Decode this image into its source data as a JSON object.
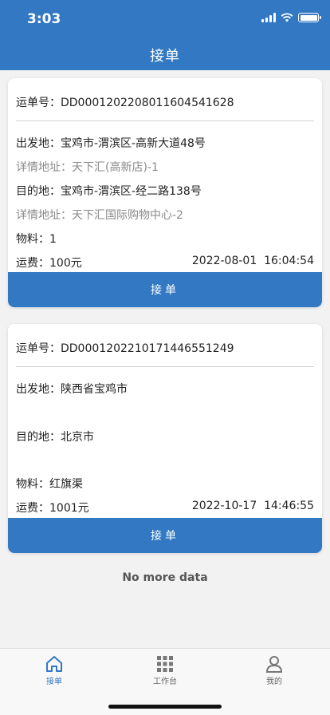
{
  "status_bar": {
    "time": "3:03"
  },
  "header": {
    "title": "接单"
  },
  "orders": [
    {
      "waybill_label": "运单号：",
      "waybill_no": "DD0001202208011604541628",
      "origin_label": "出发地：",
      "origin": "宝鸡市-渭滨区-高新大道48号",
      "origin_detail_label": "详情地址：",
      "origin_detail": "天下汇(高新店)-1",
      "dest_label": "目的地：",
      "dest": "宝鸡市-渭滨区-经二路138号",
      "dest_detail_label": "详情地址：",
      "dest_detail": "天下汇国际购物中心-2",
      "material_label": "物料：",
      "material": "1",
      "fee_label": "运费：",
      "fee": "100元",
      "datetime": "2022-08-01  16:04:54",
      "accept_label": "接单"
    },
    {
      "waybill_label": "运单号：",
      "waybill_no": "DD0001202210171446551249",
      "origin_label": "出发地：",
      "origin": "陕西省宝鸡市",
      "dest_label": "目的地：",
      "dest": "北京市",
      "material_label": "物料：",
      "material": "红旗渠",
      "fee_label": "运费：",
      "fee": "1001元",
      "datetime": "2022-10-17  14:46:55",
      "accept_label": "接单"
    }
  ],
  "list_footer": "No more data",
  "tabbar": {
    "items": [
      {
        "label": "接单",
        "icon": "home-icon",
        "active": true
      },
      {
        "label": "工作台",
        "icon": "grid-icon",
        "active": false
      },
      {
        "label": "我的",
        "icon": "person-icon",
        "active": false
      }
    ]
  },
  "colors": {
    "primary": "#3278c2",
    "background": "#f2f2f2"
  }
}
